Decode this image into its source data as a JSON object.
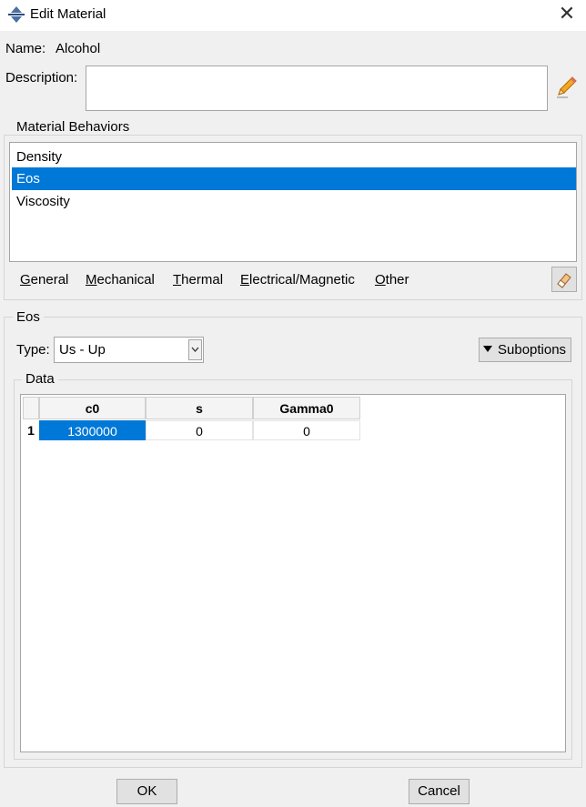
{
  "window": {
    "title": "Edit Material",
    "close_glyph": "✕"
  },
  "name": {
    "label": "Name:",
    "value": "Alcohol"
  },
  "description": {
    "label": "Description:",
    "value": ""
  },
  "material_behaviors": {
    "title": "Material Behaviors",
    "items": [
      "Density",
      "Eos",
      "Viscosity"
    ],
    "selected_index": 1
  },
  "menu": {
    "items": [
      {
        "accel": "G",
        "rest": "eneral"
      },
      {
        "accel": "M",
        "rest": "echanical"
      },
      {
        "accel": "T",
        "rest": "hermal"
      },
      {
        "accel": "E",
        "rest": "lectrical/Magnetic"
      },
      {
        "accel": "O",
        "rest": "ther"
      }
    ]
  },
  "eos": {
    "title": "Eos",
    "type_label": "Type:",
    "type_value": "Us - Up",
    "suboptions_label": "Suboptions",
    "data_title": "Data",
    "columns": [
      "c0",
      "s",
      "Gamma0"
    ],
    "rows": [
      {
        "index": "1",
        "values": [
          "1300000",
          "0",
          "0"
        ]
      }
    ]
  },
  "buttons": {
    "ok": "OK",
    "cancel": "Cancel"
  },
  "colors": {
    "selection": "#0078d7",
    "background": "#f0f0f0"
  },
  "icons": [
    "app-icon",
    "close-icon",
    "pencil-icon",
    "eraser-icon",
    "dropdown-arrow-icon",
    "triangle-down-icon"
  ]
}
